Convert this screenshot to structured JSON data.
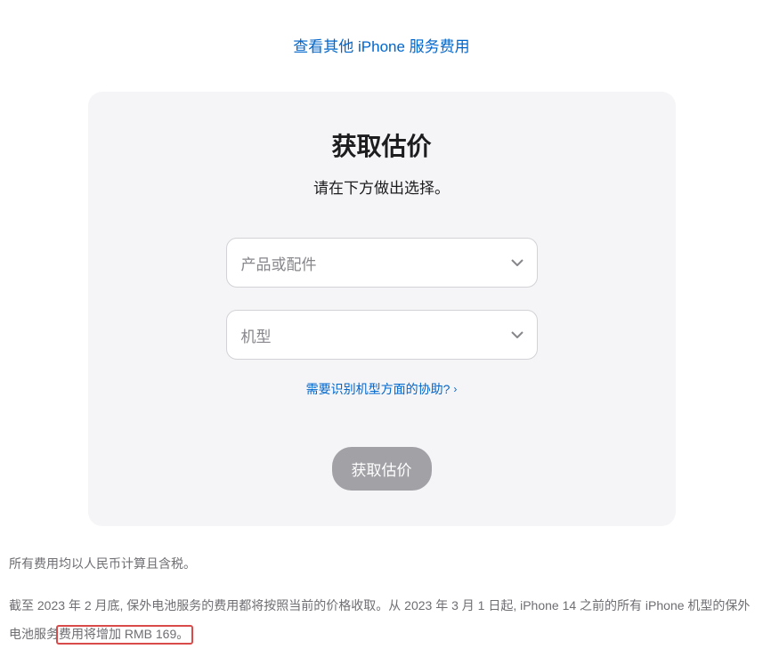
{
  "topLink": {
    "label": "查看其他 iPhone 服务费用"
  },
  "card": {
    "title": "获取估价",
    "subtitle": "请在下方做出选择。",
    "select1": {
      "placeholder": "产品或配件"
    },
    "select2": {
      "placeholder": "机型"
    },
    "helpLink": {
      "label": "需要识别机型方面的协助?"
    },
    "submitButton": {
      "label": "获取估价"
    }
  },
  "footer": {
    "line1": "所有费用均以人民币计算且含税。",
    "line2_part1": "截至 2023 年 2 月底, 保外电池服务的费用都将按照当前的价格收取。从 2023 年 3 月 1 日起, iPhone 14 之前的所有 iPhone 机型的保外电池服务",
    "line2_highlight": "费用将增加 RMB 169。"
  }
}
